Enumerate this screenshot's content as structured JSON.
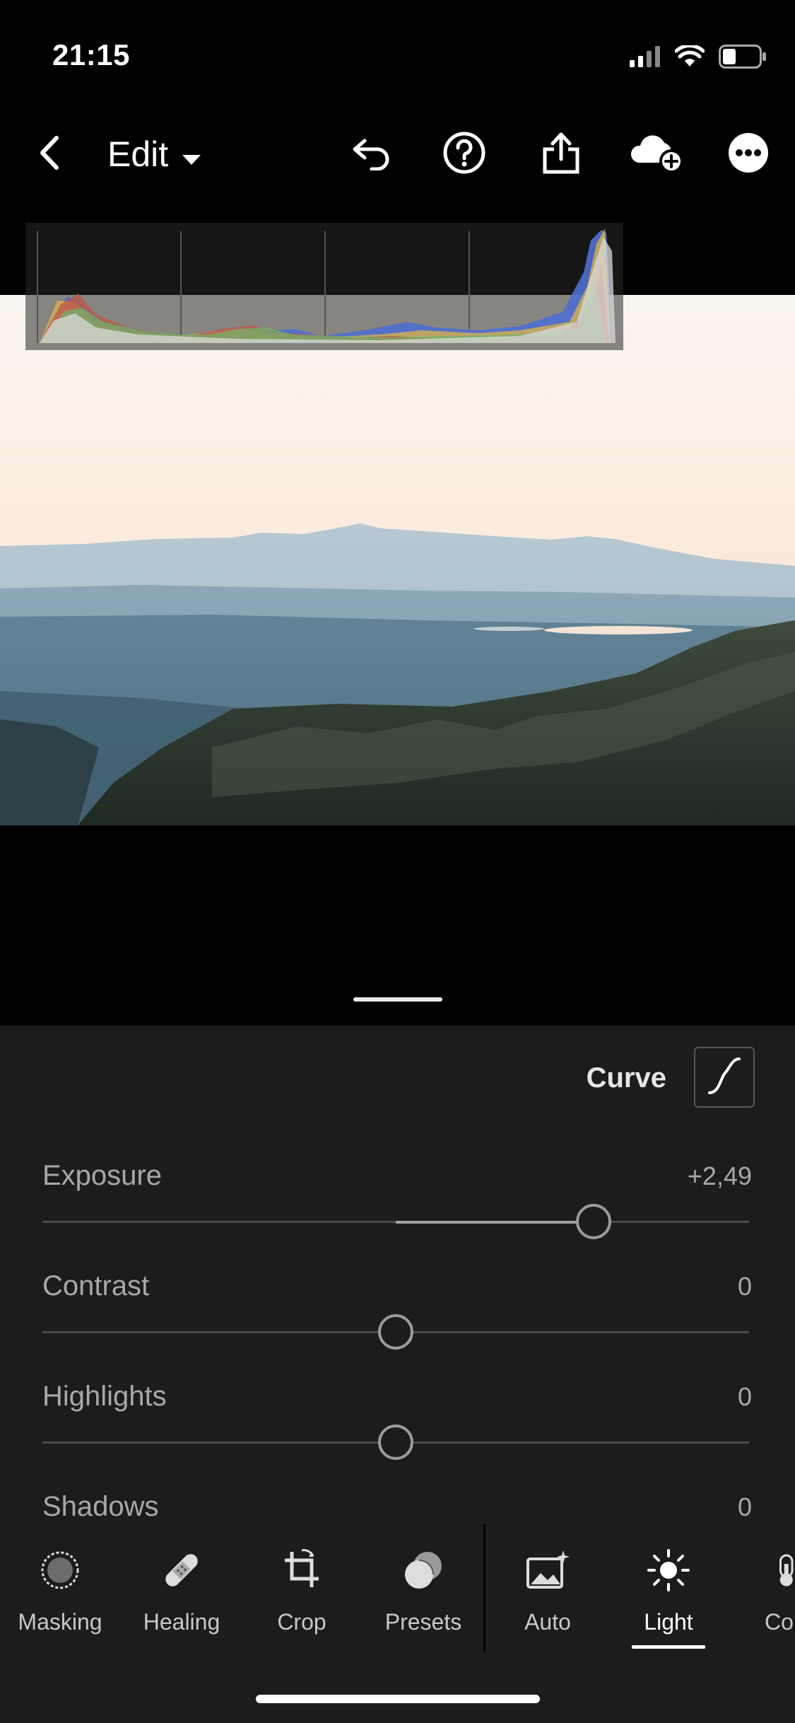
{
  "status_bar": {
    "time": "21:15",
    "icons": [
      "cellular-signal-icon",
      "wifi-icon",
      "battery-icon"
    ]
  },
  "top_bar": {
    "back_icon": "chevron-left-icon",
    "title": "Edit",
    "title_dropdown_icon": "caret-down-icon",
    "actions": [
      "undo-icon",
      "help-icon",
      "share-icon",
      "cloud-add-icon",
      "more-icon"
    ]
  },
  "histogram": {
    "channels": [
      "red",
      "green",
      "yellow",
      "blue",
      "luminance"
    ]
  },
  "adjust_panel": {
    "curve_label": "Curve",
    "curve_icon": "tone-curve-icon",
    "sliders": [
      {
        "label": "Exposure",
        "value": "+2,49",
        "position": 0.78
      },
      {
        "label": "Contrast",
        "value": "0",
        "position": 0.5
      },
      {
        "label": "Highlights",
        "value": "0",
        "position": 0.5
      },
      {
        "label": "Shadows",
        "value": "0",
        "position": 0.5
      }
    ]
  },
  "toolbar": {
    "tools": [
      {
        "label": "Masking",
        "icon": "masking-icon"
      },
      {
        "label": "Healing",
        "icon": "bandage-icon"
      },
      {
        "label": "Crop",
        "icon": "crop-rotate-icon"
      },
      {
        "label": "Presets",
        "icon": "presets-icon"
      },
      {
        "label": "Auto",
        "icon": "auto-image-icon"
      },
      {
        "label": "Light",
        "icon": "sun-icon"
      },
      {
        "label": "Col",
        "icon": "thermometer-icon"
      }
    ],
    "active_tool": "Light"
  },
  "colors": {
    "background": "#000000",
    "panel": "#1c1c1c",
    "text_muted": "#a8a8a8",
    "text_active": "#ffffff"
  }
}
